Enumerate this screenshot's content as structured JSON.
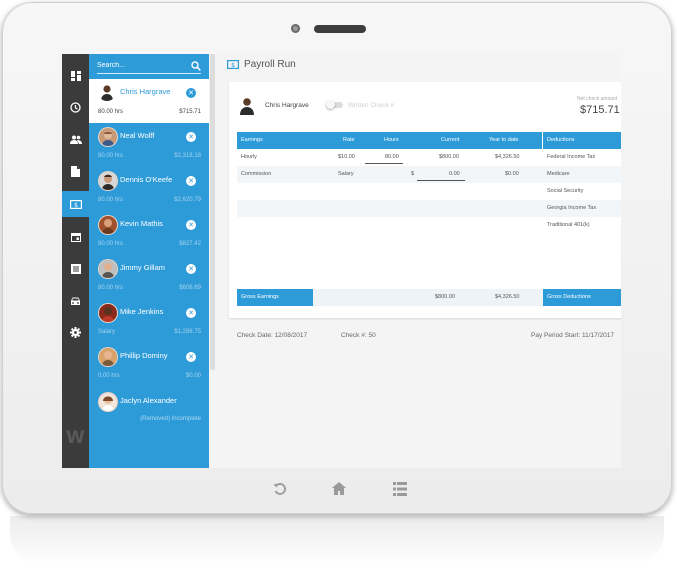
{
  "colors": {
    "accent": "#2e9bd9",
    "rail": "#3b3b3b",
    "bezel": "#f2f2f2"
  },
  "rail_icons": [
    "dashboard-icon",
    "clock-icon",
    "people-icon",
    "document-icon",
    "payroll-icon",
    "calendar-icon",
    "list-icon",
    "car-icon",
    "gear-icon"
  ],
  "search": {
    "placeholder": "Search..."
  },
  "employees": [
    {
      "name": "Chris Hargrave",
      "sub": "80.00 hrs",
      "amount": "$715.71",
      "selected": true
    },
    {
      "name": "Neal Wolff",
      "sub": "80.00 hrs",
      "amount": "$2,318.18"
    },
    {
      "name": "Dennis O'Keefe",
      "sub": "80.00 hrs",
      "amount": "$2,620.79"
    },
    {
      "name": "Kevin Mathis",
      "sub": "80.00 hrs",
      "amount": "$827.42"
    },
    {
      "name": "Jimmy Gillam",
      "sub": "80.00 hrs",
      "amount": "$608.69"
    },
    {
      "name": "Mike Jenkins",
      "sub": "Salary",
      "amount": "$1,288.75"
    },
    {
      "name": "Phillip Dominy",
      "sub": "0.00 hrs",
      "amount": "$0.00"
    },
    {
      "name": "Jaclyn Alexander",
      "note": "(Removed) Incomplete"
    }
  ],
  "page": {
    "title": "Payroll Run"
  },
  "card": {
    "employee": "Chris Hargrave",
    "toggle_label": "Written Check #",
    "net_label": "Net check amount",
    "net_value": "$715.71"
  },
  "table": {
    "headers": {
      "earnings": "Earnings",
      "rate": "Rate",
      "hours": "Hours",
      "current": "Current",
      "ytd": "Year to date",
      "deductions": "Deductions"
    },
    "rows": [
      {
        "earnings": "Hourly",
        "rate": "$10.00",
        "hours": "80.00",
        "current": "$800.00",
        "ytd": "$4,326.50"
      },
      {
        "earnings": "Commission",
        "rate": "Salary",
        "hours_prefix": "$",
        "hours": "0.00",
        "current": "$0.00",
        "ytd": "$0.00"
      }
    ],
    "deductions": [
      "Federal Income Tax",
      "Medicare",
      "Social Security",
      "Georgia Income Tax",
      "Traditional 401(k)"
    ],
    "totals": {
      "gross_label": "Gross Earnings",
      "gross_current": "$800.00",
      "gross_ytd": "$4,326.50",
      "deductions_label": "Gross Deductions"
    }
  },
  "footer": {
    "check_date": "Check Date: 12/08/2017",
    "check_no": "Check #: 50",
    "pay_period": "Pay Period Start: 11/17/2017"
  },
  "device_buttons": [
    "back-icon",
    "home-icon",
    "menu-icon"
  ]
}
